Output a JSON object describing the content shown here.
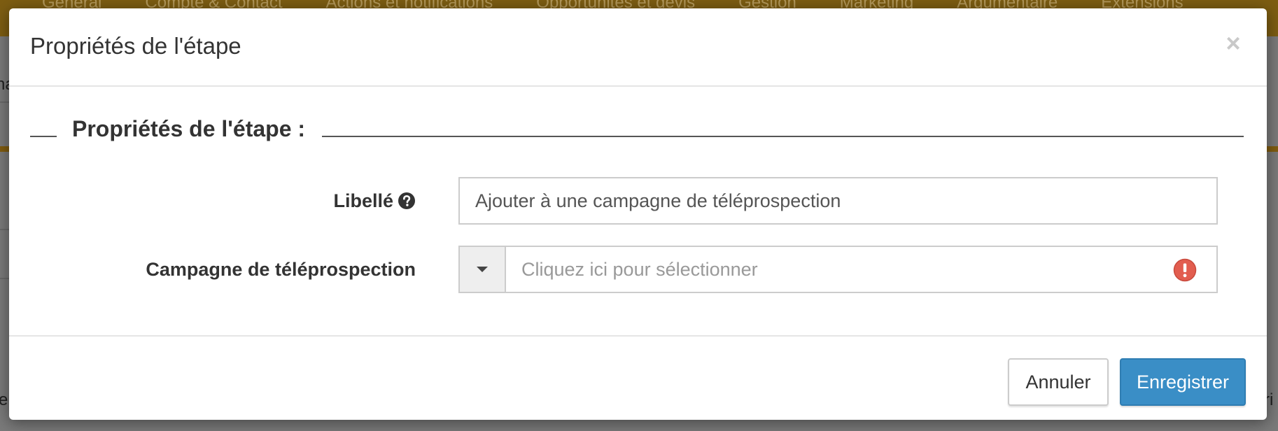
{
  "background": {
    "top_nav": [
      "Général",
      "Compte & Contact",
      "Actions et notifications",
      "Opportunités et devis",
      "Gestion",
      "Marketing",
      "Argumentaire",
      "Extensions"
    ],
    "left_edge_fragment_1": "na",
    "left_edge_fragment_2": "e",
    "right_edge_fragment": "ri"
  },
  "modal": {
    "title": "Propriétés de l'étape",
    "close_label": "×",
    "section_legend": "Propriétés de l'étape :",
    "fields": {
      "libelle": {
        "label": "Libellé",
        "value": "Ajouter à une campagne de téléprospection"
      },
      "campagne": {
        "label": "Campagne de téléprospection",
        "placeholder": "Cliquez ici pour sélectionner"
      }
    },
    "buttons": {
      "cancel": "Annuler",
      "save": "Enregistrer"
    }
  },
  "colors": {
    "top_nav_bg": "#7d5d12",
    "primary_button": "#3a8ec6",
    "error_icon": "#e25d4f"
  },
  "icons": {
    "help": "question-circle-icon",
    "close": "close-icon",
    "dropdown": "caret-down-icon",
    "error": "exclamation-circle-icon"
  }
}
